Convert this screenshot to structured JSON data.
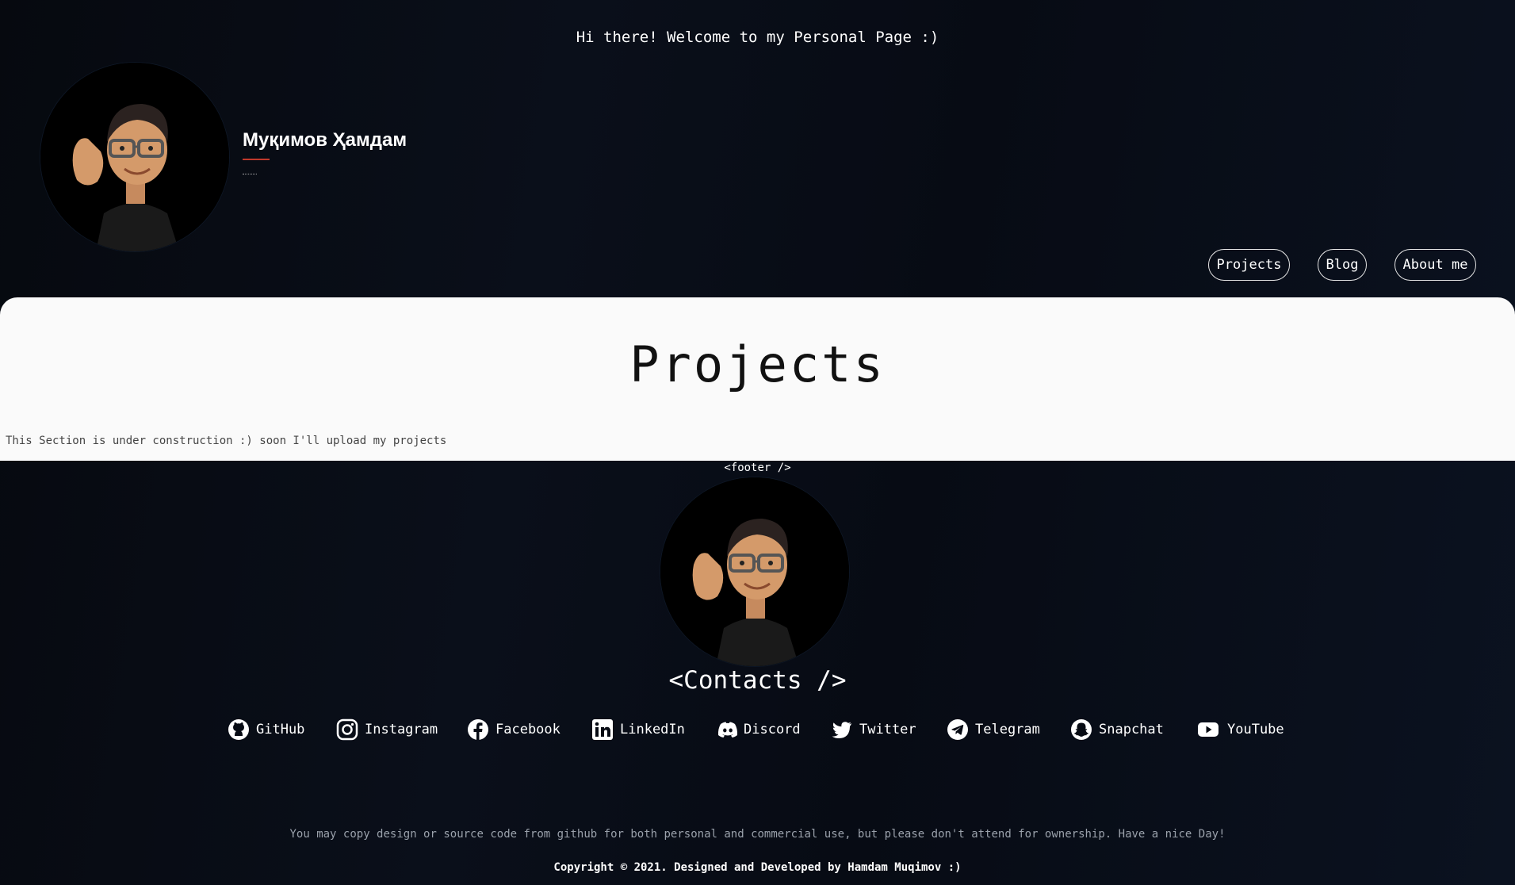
{
  "header": {
    "greeting": "Hi there! Welcome to my Personal Page :)",
    "name": "Муқимов Ҳамдам"
  },
  "nav": {
    "items": [
      {
        "label": "Projects"
      },
      {
        "label": "Blog"
      },
      {
        "label": "About me"
      }
    ]
  },
  "main": {
    "title": "Projects",
    "text": "This Section is under construction :) soon I'll upload my projects"
  },
  "footer": {
    "tag": "<footer />",
    "contacts_title": "<Contacts />",
    "contacts": [
      {
        "label": "GitHub",
        "icon": "github-icon"
      },
      {
        "label": "Instagram",
        "icon": "instagram-icon"
      },
      {
        "label": "Facebook",
        "icon": "facebook-icon"
      },
      {
        "label": "LinkedIn",
        "icon": "linkedin-icon"
      },
      {
        "label": "Discord",
        "icon": "discord-icon"
      },
      {
        "label": "Twitter",
        "icon": "twitter-icon"
      },
      {
        "label": "Telegram",
        "icon": "telegram-icon"
      },
      {
        "label": "Snapchat",
        "icon": "snapchat-icon"
      },
      {
        "label": "YouTube",
        "icon": "youtube-icon"
      }
    ],
    "disclaimer": "You may copy design or source code from github for both personal and commercial use, but please don't attend for ownership. Have a nice Day!",
    "copyright": "Copyright © 2021. Designed and Developed by Hamdam Muqimov :)"
  },
  "colors": {
    "background": "#070b14",
    "panel": "#fafafa",
    "accent": "#c0392b"
  }
}
